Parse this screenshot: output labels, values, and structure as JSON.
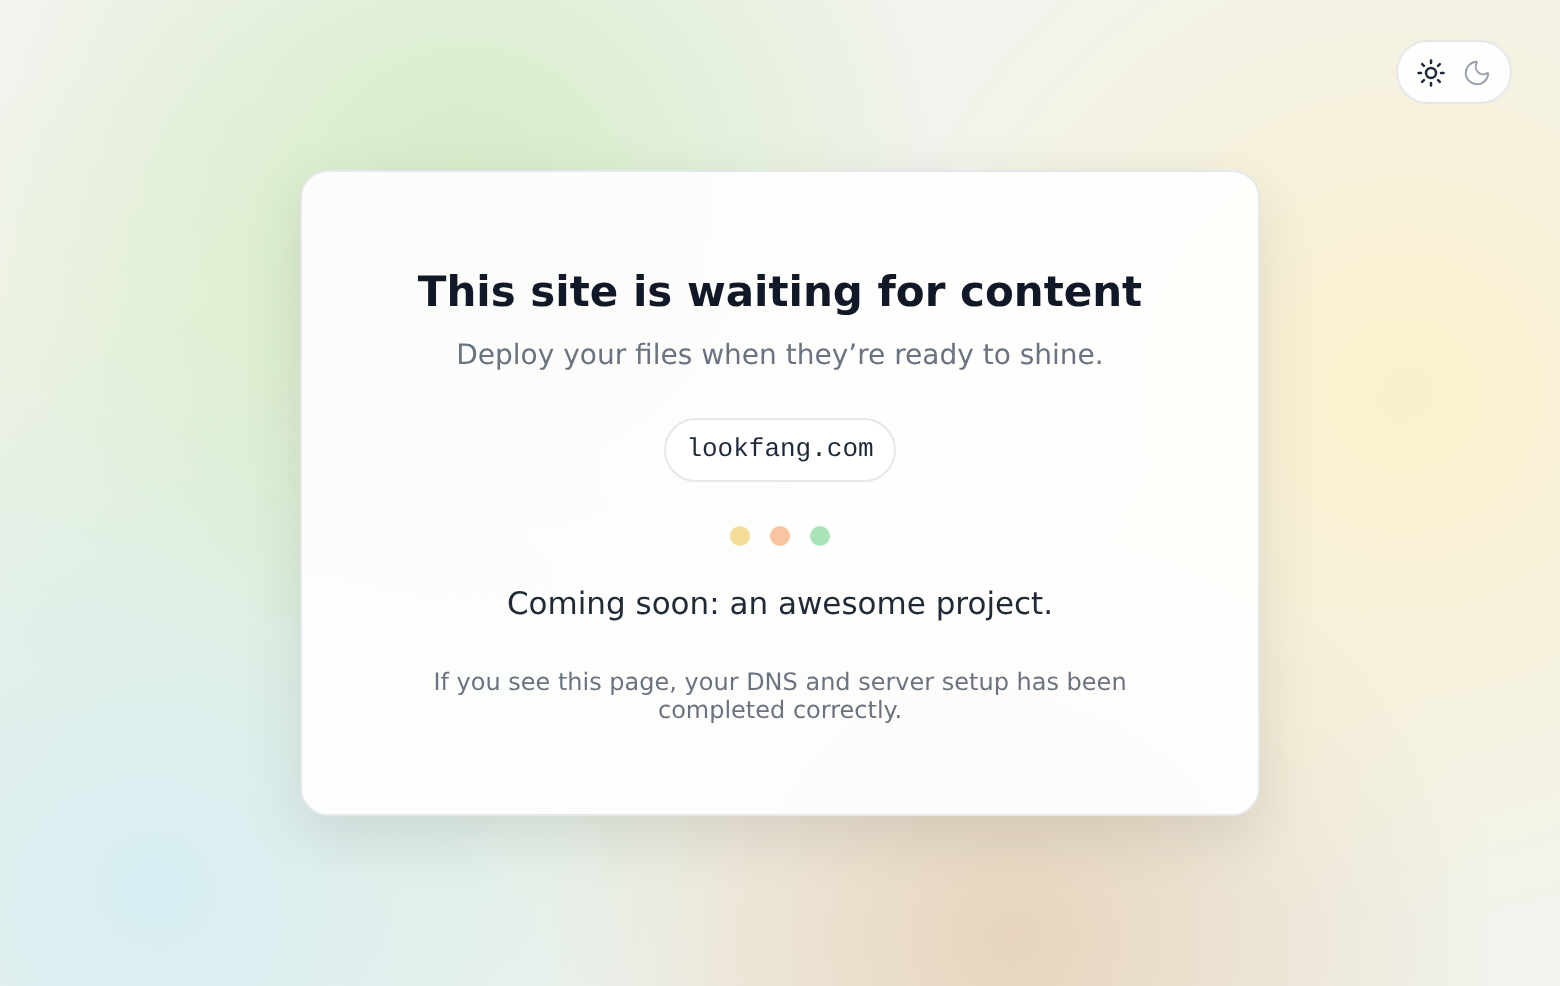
{
  "theme_toggle": [
    {
      "kind": "light",
      "selected": true
    },
    {
      "kind": "dark",
      "selected": false
    }
  ],
  "card": {
    "title": "This site is waiting for content",
    "subtitle": "Deploy your files when they’re ready to shine.",
    "domain": "lookfang.com",
    "dots": [
      {
        "color": "#f3dc95"
      },
      {
        "color": "#f9c4a0"
      },
      {
        "color": "#a8e4b8"
      }
    ],
    "tagline": "Coming soon: an awesome project.",
    "note": "If you see this page, your DNS and server setup has been completed correctly."
  }
}
